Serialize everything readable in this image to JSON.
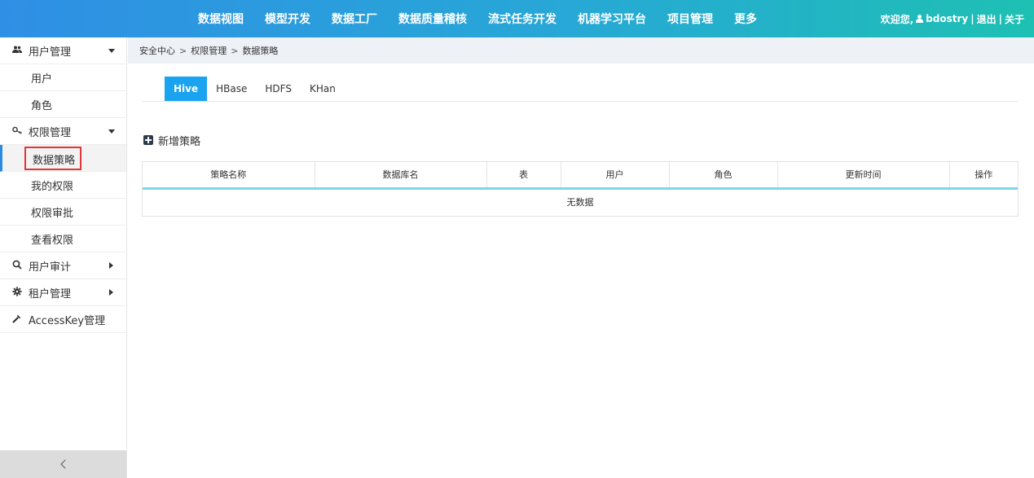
{
  "topnav": {
    "items": [
      "数据视图",
      "模型开发",
      "数据工厂",
      "数据质量稽核",
      "流式任务开发",
      "机器学习平台",
      "项目管理",
      "更多"
    ]
  },
  "user": {
    "welcome": "欢迎您,",
    "name": "bdostry",
    "logout": "退出",
    "about": "关于",
    "separator": "|"
  },
  "sidebar": {
    "groups": [
      {
        "label": "用户管理",
        "icon": "users-icon",
        "items": [
          "用户",
          "角色"
        ]
      },
      {
        "label": "权限管理",
        "icon": "key-icon",
        "items": [
          "数据策略",
          "我的权限",
          "权限审批",
          "查看权限"
        ]
      },
      {
        "label": "用户审计",
        "icon": "search-icon"
      },
      {
        "label": "租户管理",
        "icon": "gear-icon"
      },
      {
        "label": "AccessKey管理",
        "icon": "wrench-icon"
      }
    ],
    "active_item": "数据策略"
  },
  "breadcrumb": [
    "安全中心",
    "权限管理",
    "数据策略"
  ],
  "breadcrumb_sep": ">",
  "tabs": [
    "Hive",
    "HBase",
    "HDFS",
    "KHan"
  ],
  "active_tab": "Hive",
  "add_button": "新增策略",
  "table": {
    "columns": [
      "策略名称",
      "数据库名",
      "表",
      "用户",
      "角色",
      "更新时间",
      "操作"
    ],
    "empty_text": "无数据"
  },
  "colors": {
    "header_start": "#2f8fe5",
    "header_end": "#1ec0b3",
    "tab_active": "#1aa3f0",
    "highlight_box": "#e0363a",
    "table_header_underline": "#7fd6e8"
  }
}
